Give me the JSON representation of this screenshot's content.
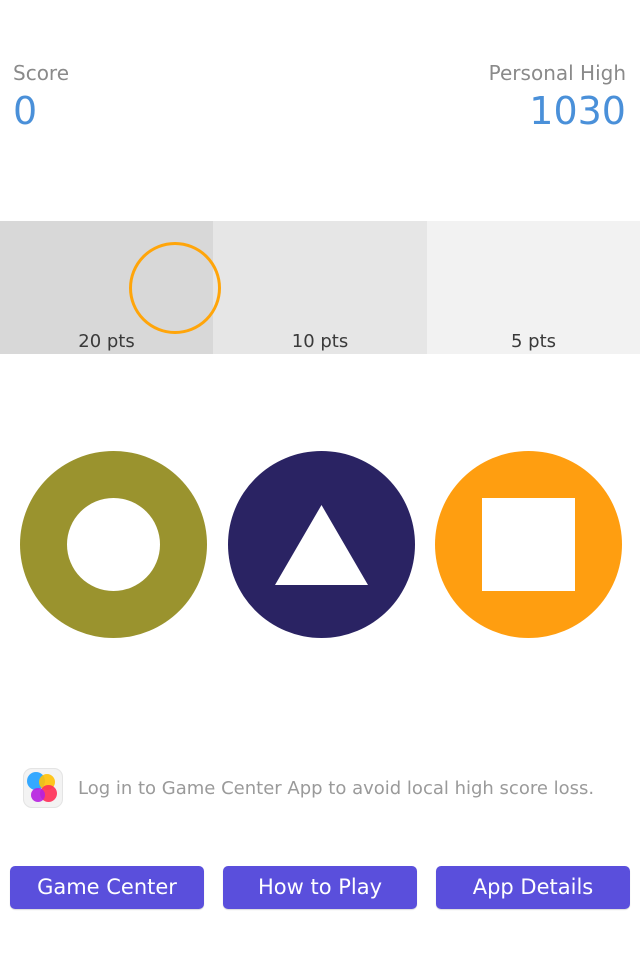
{
  "score": {
    "label": "Score",
    "value": "0"
  },
  "high": {
    "label": "Personal High",
    "value": "1030"
  },
  "zones": [
    {
      "label": "20 pts"
    },
    {
      "label": "10 pts"
    },
    {
      "label": "5 pts"
    }
  ],
  "shapes": [
    {
      "name": "circle",
      "color": "#9a932e"
    },
    {
      "name": "triangle",
      "color": "#2a2363"
    },
    {
      "name": "square",
      "color": "#ff9e10"
    }
  ],
  "target_color": "#ffa50a",
  "accent_color": "#4a90d9",
  "game_center": {
    "icon": "game-center-icon",
    "message": "Log in to Game Center App to avoid local high score loss."
  },
  "buttons": {
    "game_center": "Game Center",
    "how_to_play": "How to Play",
    "app_details": "App Details",
    "color": "#5a4fdc"
  }
}
